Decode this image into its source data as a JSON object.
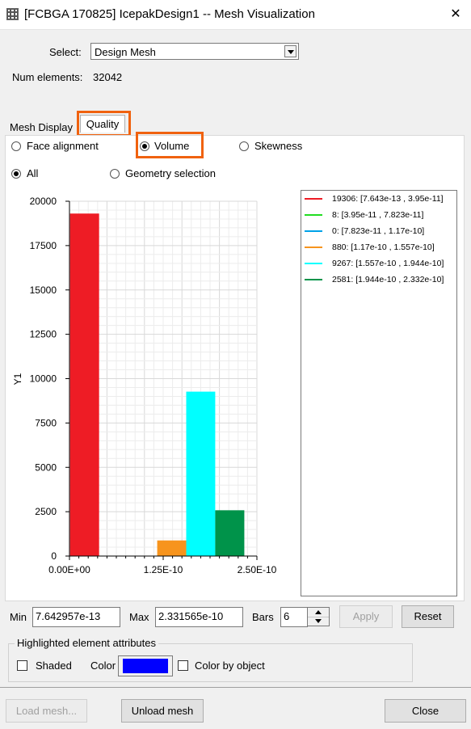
{
  "window": {
    "title": "[FCBGA 170825] IcepakDesign1 -- Mesh Visualization",
    "close_glyph": "✕"
  },
  "select": {
    "label": "Select:",
    "value": "Design Mesh"
  },
  "num_elements": {
    "label": "Num elements:",
    "value": "32042"
  },
  "tabs": [
    {
      "label": "Mesh Display"
    },
    {
      "label": "Quality"
    }
  ],
  "quality_options": [
    {
      "label": "Face alignment"
    },
    {
      "label": "Volume",
      "checked": true
    },
    {
      "label": "Skewness"
    }
  ],
  "scope_options": [
    {
      "label": "All",
      "checked": true
    },
    {
      "label": "Geometry selection"
    }
  ],
  "chart_data": {
    "type": "bar",
    "title": "",
    "xlabel": "",
    "ylabel": "Y1",
    "ylim": [
      0,
      20000
    ],
    "xlim": [
      0,
      2.5e-10
    ],
    "y_ticks": [
      "0",
      "2500",
      "5000",
      "7500",
      "10000",
      "12500",
      "15000",
      "17500",
      "20000"
    ],
    "x_ticks": [
      "0.00E+00",
      "1.25E-10",
      "2.50E-10"
    ],
    "grid": true,
    "legend_position": "right",
    "bars": [
      {
        "value": 19306,
        "x_start": 7.643e-13,
        "x_end": 3.95e-11,
        "color": "#ee1c25",
        "legend": "19306: [7.643e-13 ,   3.95e-11]"
      },
      {
        "value": 8,
        "x_start": 3.95e-11,
        "x_end": 7.823e-11,
        "color": "#22dd22",
        "legend": "8: [3.95e-11 ,  7.823e-11]"
      },
      {
        "value": 0,
        "x_start": 7.823e-11,
        "x_end": 1.17e-10,
        "color": "#00a2e8",
        "legend": "0: [7.823e-11 ,   1.17e-10]"
      },
      {
        "value": 880,
        "x_start": 1.17e-10,
        "x_end": 1.557e-10,
        "color": "#f7941d",
        "legend": "880: [1.17e-10  ,  1.557e-10]"
      },
      {
        "value": 9267,
        "x_start": 1.557e-10,
        "x_end": 1.944e-10,
        "color": "#00ffff",
        "legend": "9267: [1.557e-10 ,  1.944e-10]"
      },
      {
        "value": 2581,
        "x_start": 1.944e-10,
        "x_end": 2.332e-10,
        "color": "#00934a",
        "legend": "2581: [1.944e-10 ,  2.332e-10]"
      }
    ]
  },
  "range": {
    "min_label": "Min",
    "min_value": "7.642957e-13",
    "max_label": "Max",
    "max_value": "2.331565e-10",
    "bars_label": "Bars",
    "bars_value": "6",
    "apply_label": "Apply",
    "reset_label": "Reset"
  },
  "attributes": {
    "group_title": "Highlighted element attributes",
    "shaded_label": "Shaded",
    "color_label": "Color",
    "color_value": "#0000ff",
    "color_by_object_label": "Color by object"
  },
  "footer": {
    "load_label": "Load mesh...",
    "unload_label": "Unload mesh",
    "close_label": "Close"
  }
}
